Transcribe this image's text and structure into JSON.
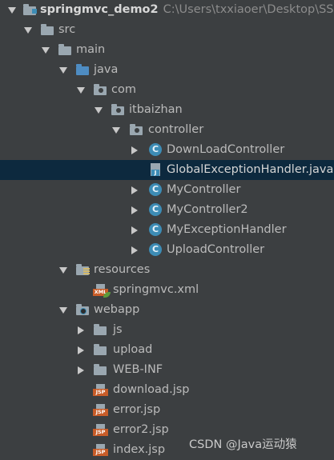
{
  "project": {
    "name": "springmvc_demo2",
    "path": "C:\\Users\\txxiaoer\\Desktop\\SSI"
  },
  "tree": {
    "src": "src",
    "main": "main",
    "java": "java",
    "com": "com",
    "itbaizhan": "itbaizhan",
    "controller": "controller",
    "classes": [
      "DownLoadController",
      "GlobalExceptionHandler.java",
      "MyController",
      "MyController2",
      "MyExceptionHandler",
      "UploadController"
    ],
    "resources": "resources",
    "springmvc_xml": "springmvc.xml",
    "webapp": "webapp",
    "js": "js",
    "upload": "upload",
    "webinf": "WEB-INF",
    "jsp_files": [
      "download.jsp",
      "error.jsp",
      "error2.jsp",
      "index.jsp"
    ]
  },
  "icons": {
    "class_letter": "C",
    "jsp_tag": "JSP",
    "xml_tag": "XML"
  },
  "watermark": "CSDN @Java运动猿",
  "colors": {
    "background": "#3c3f41",
    "selected_row": "#0d293e",
    "class_icon": "#3d8cb5",
    "source_folder": "#4e8cc2",
    "jsp_badge": "#c85d29"
  }
}
